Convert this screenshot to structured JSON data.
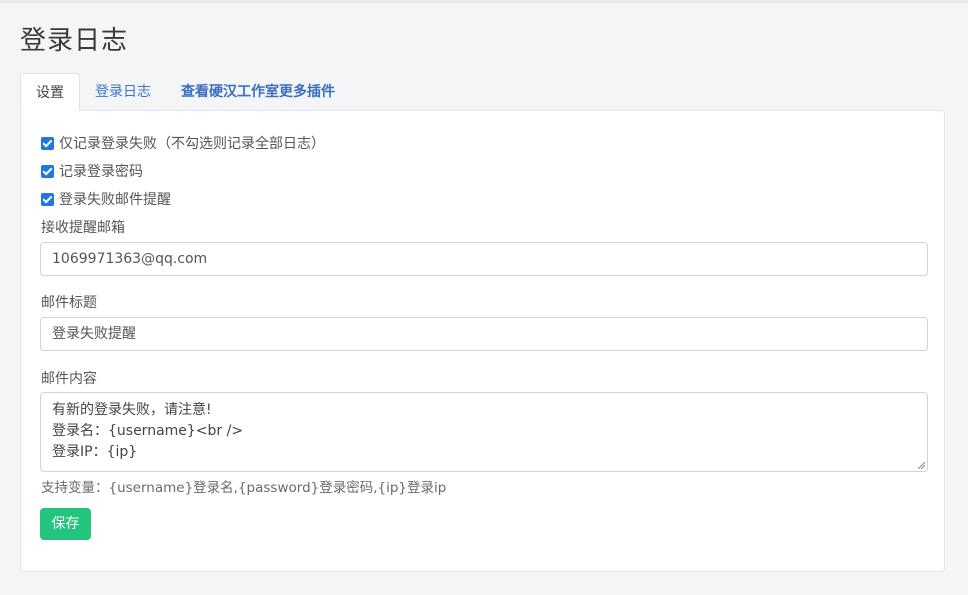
{
  "page": {
    "title": "登录日志"
  },
  "tabs": [
    {
      "label": "设置",
      "active": true
    },
    {
      "label": "登录日志",
      "active": false
    },
    {
      "label": "查看硬汉工作室更多插件",
      "active": false
    }
  ],
  "settings": {
    "only_failed": {
      "label": "仅记录登录失败（不勾选则记录全部日志）",
      "checked": true
    },
    "record_password": {
      "label": "记录登录密码",
      "checked": true
    },
    "email_alert": {
      "label": "登录失败邮件提醒",
      "checked": true
    },
    "email_field": {
      "label": "接收提醒邮箱",
      "value": "1069971363@qq.com"
    },
    "subject_field": {
      "label": "邮件标题",
      "value": "登录失败提醒"
    },
    "content_field": {
      "label": "邮件内容",
      "lines": [
        "有新的登录失败，请注意!",
        "登录名：{username}<br />",
        "登录IP：{ip}"
      ]
    },
    "help_text": "支持变量：{username}登录名,{password}登录密码,{ip}登录ip",
    "save_label": "保存"
  },
  "colors": {
    "accent_blue": "#1f77e6",
    "save_green": "#22c47e",
    "tab_link": "#3a74cc"
  }
}
